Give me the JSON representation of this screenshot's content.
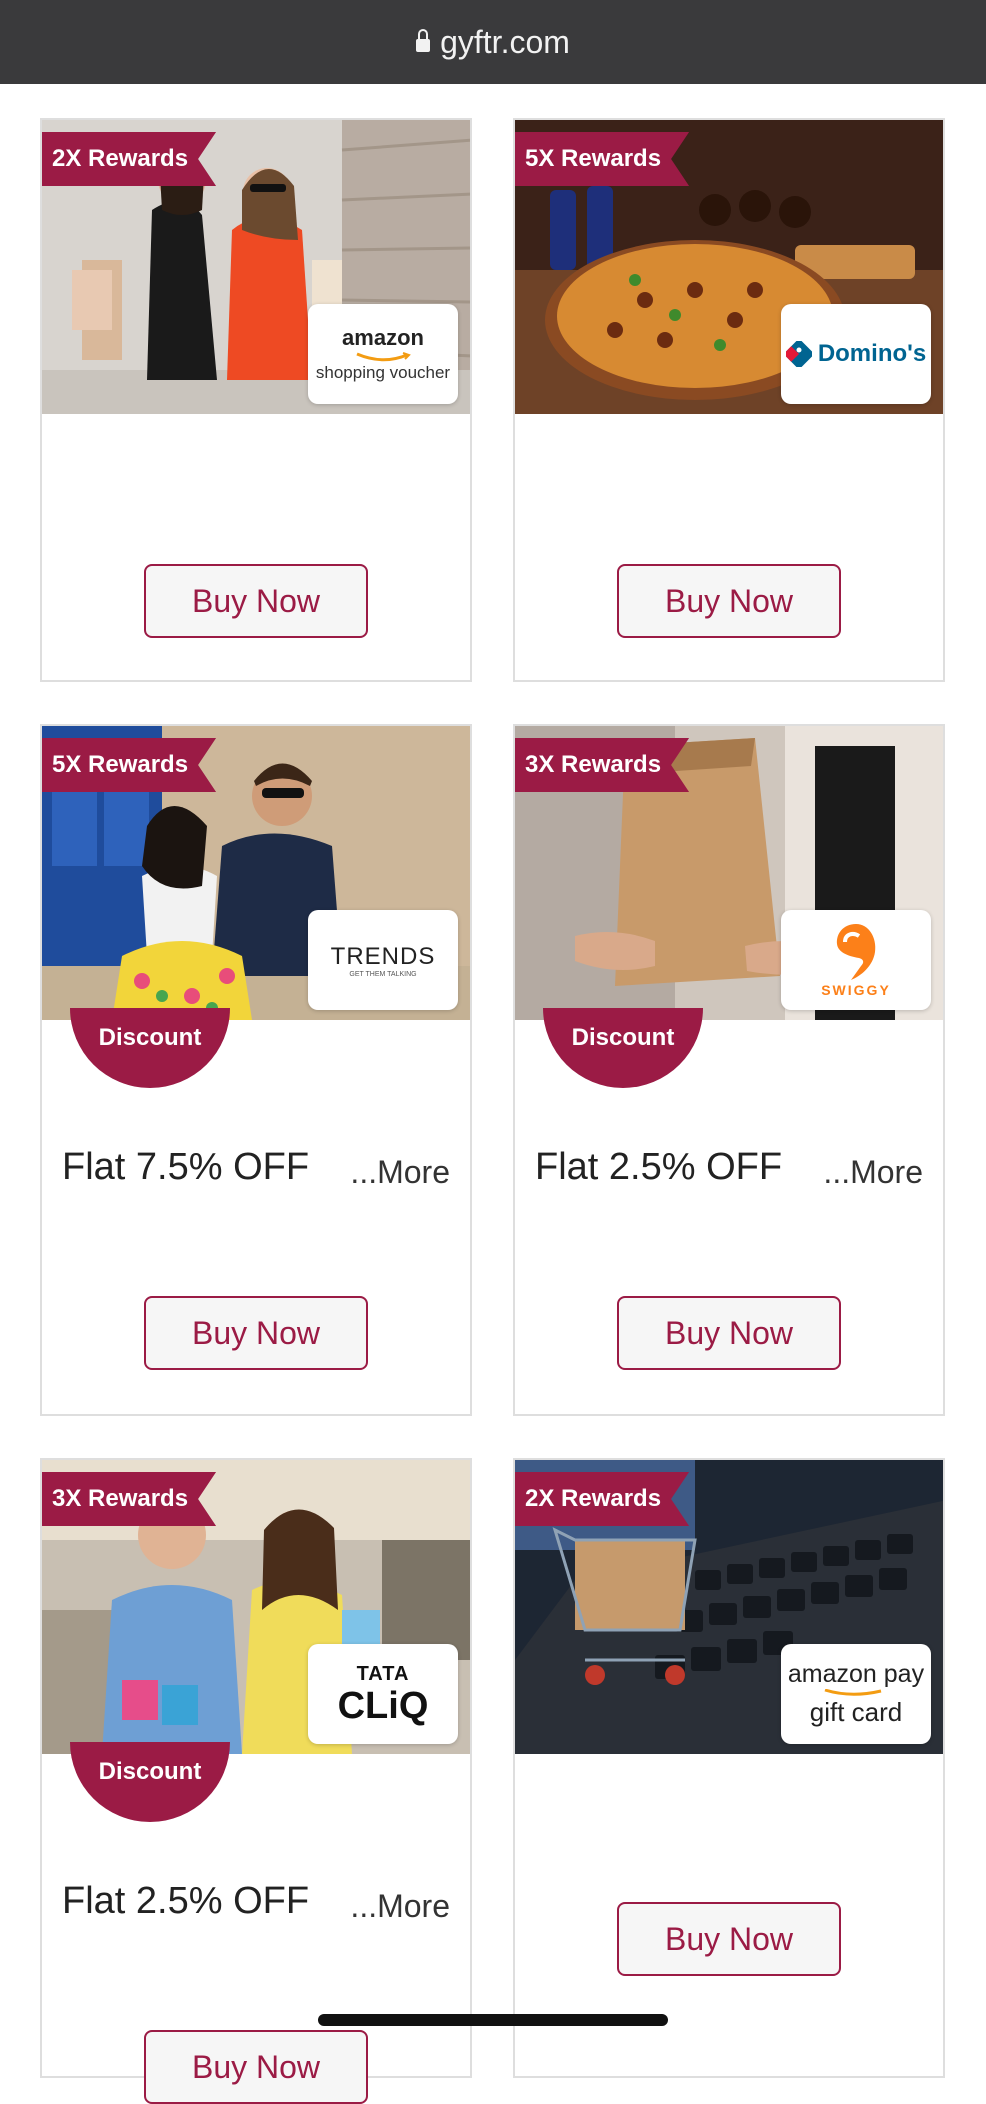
{
  "browser": {
    "url": "gyftr.com"
  },
  "cards": [
    {
      "reward": "2X Rewards",
      "brand": "amazon",
      "brand_sub": "shopping voucher",
      "buy_label": "Buy Now"
    },
    {
      "reward": "5X Rewards",
      "brand": "Domino's",
      "buy_label": "Buy Now"
    },
    {
      "reward": "5X Rewards",
      "brand": "TRENDS",
      "brand_sub": "GET THEM TALKING",
      "badge": "Discount",
      "offer": "Flat 7.5% OFF",
      "more": "...More",
      "buy_label": "Buy Now"
    },
    {
      "reward": "3X Rewards",
      "brand": "SWIGGY",
      "badge": "Discount",
      "offer": "Flat 2.5% OFF",
      "more": "...More",
      "buy_label": "Buy Now"
    },
    {
      "reward": "3X Rewards",
      "brand": "TATA",
      "brand_sub": "CLiQ",
      "badge": "Discount",
      "offer": "Flat 2.5% OFF",
      "more": "...More",
      "buy_label": "Buy Now"
    },
    {
      "reward": "2X Rewards",
      "brand": "amazon pay",
      "brand_sub": "gift card",
      "buy_label": "Buy Now"
    }
  ],
  "colors": {
    "accent": "#9b1b45",
    "urlbar": "#3a3a3c"
  }
}
